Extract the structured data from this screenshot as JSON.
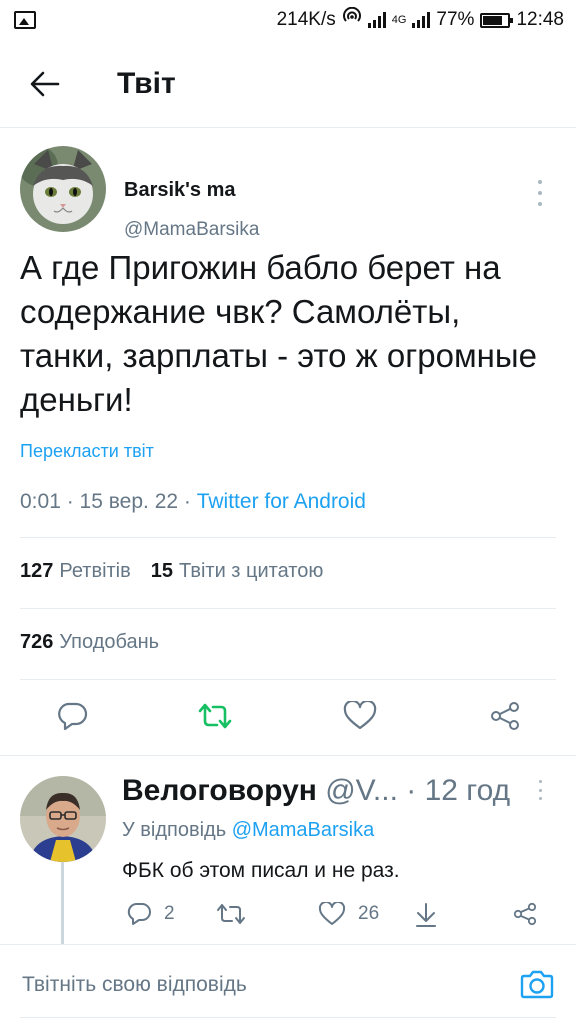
{
  "status_bar": {
    "speed": "214K/s",
    "network": "4G",
    "battery": "77%",
    "time": "12:48"
  },
  "header": {
    "title": "Твіт"
  },
  "tweet": {
    "author_name": "Barsik's ma",
    "author_handle": "@MamaBarsika",
    "text": "А где Пригожин бабло берет на содержание чвк? Самолёты, танки, зарплаты - это ж огромные деньги!",
    "translate_label": "Перекласти твіт",
    "time": "0:01",
    "date": "15 вер. 22",
    "source": "Twitter for Android",
    "retweets_count": "127",
    "retweets_label": "Ретвітів",
    "quotes_count": "15",
    "quotes_label": "Твіти з цитатою",
    "likes_count": "726",
    "likes_label": "Уподобань"
  },
  "reply": {
    "author_name": "Велоговорун",
    "author_handle": "@V...",
    "time": "· 12 год",
    "reply_to_label": "У відповідь",
    "reply_to_handle": "@MamaBarsika",
    "text": "ФБК об этом писал и не раз.",
    "replies_count": "2",
    "likes_count": "26"
  },
  "compose": {
    "placeholder": "Твітніть свою відповідь"
  },
  "colors": {
    "accent": "#1da1f2",
    "retweet_green": "#17bf63",
    "secondary_text": "#657786"
  },
  "icons": {
    "back": "arrow-left-icon",
    "more": "more-vertical-icon",
    "reply": "reply-icon",
    "retweet": "retweet-icon",
    "like": "heart-icon",
    "share": "share-icon",
    "download": "download-icon",
    "camera": "camera-icon"
  }
}
